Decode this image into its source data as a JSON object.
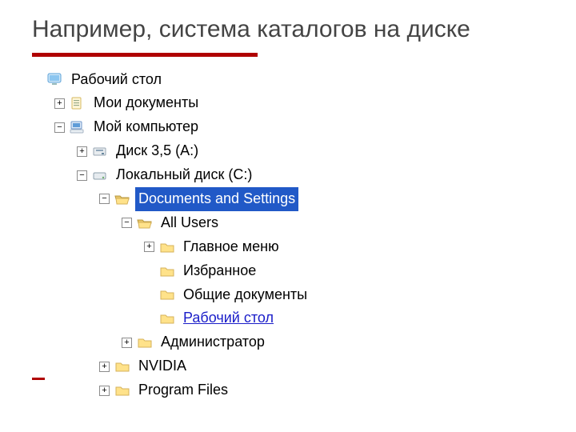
{
  "title": "Например, система каталогов на диске",
  "tree": {
    "desktop": "Рабочий стол",
    "mydocs": "Мои документы",
    "mycomp": "Мой компьютер",
    "floppy": "Диск 3,5 (A:)",
    "localc": "Локальный диск (C:)",
    "docset": "Documents and Settings",
    "allusers": "All Users",
    "mainmenu": "Главное меню",
    "favorites": "Избранное",
    "shareddocs": "Общие документы",
    "desktop2": "Рабочий стол",
    "admin": "Администратор",
    "nvidia": "NVIDIA",
    "progfiles": "Program Files"
  },
  "glyph": {
    "plus": "+",
    "minus": "−"
  }
}
